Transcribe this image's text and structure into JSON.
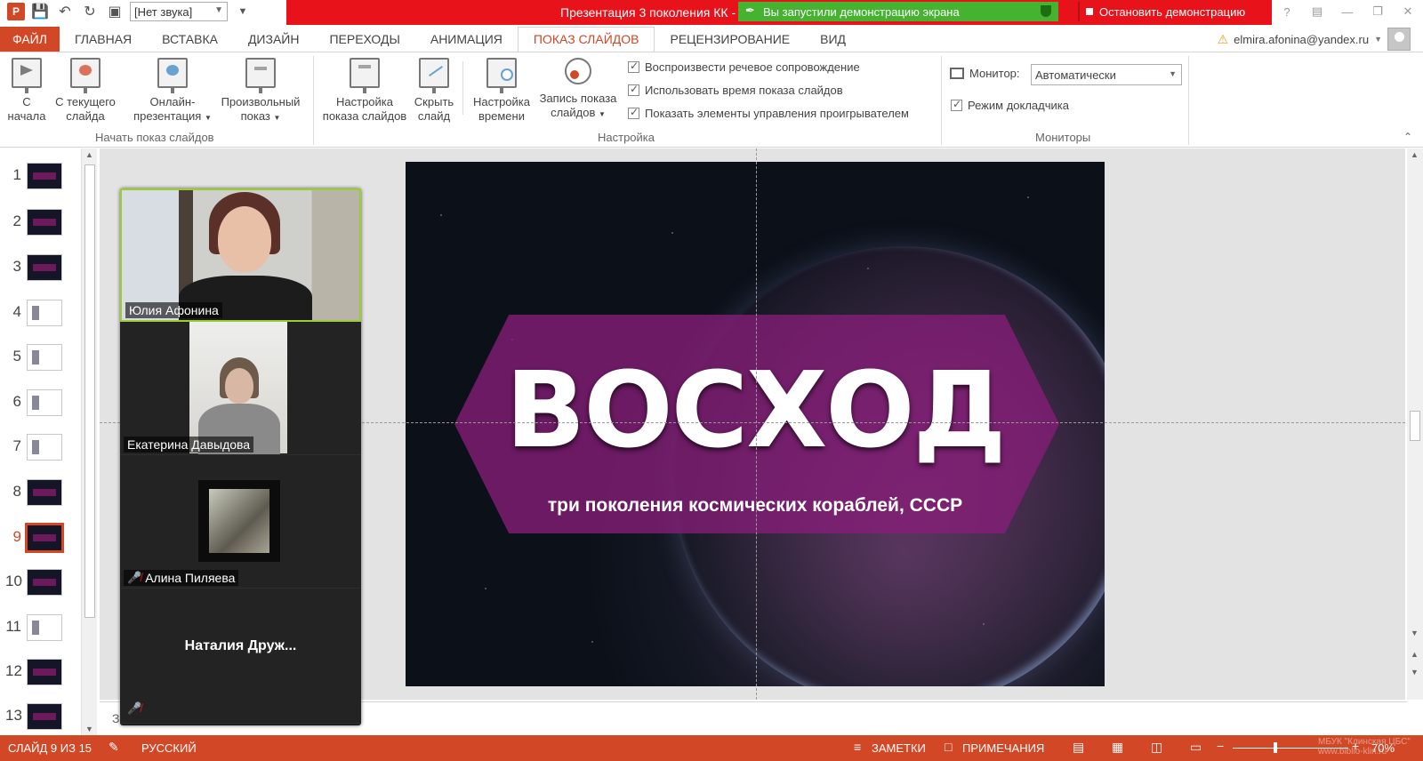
{
  "titlebar": {
    "sound_select": "[Нет звука]",
    "document_title": "Презентация 3 поколения КК -",
    "share_status": "Вы запустили демонстрацию экрана",
    "stop_button": "Остановить демонстрацию"
  },
  "tabs": [
    "ФАЙЛ",
    "ГЛАВНАЯ",
    "ВСТАВКА",
    "ДИЗАЙН",
    "ПЕРЕХОДЫ",
    "АНИМАЦИЯ",
    "ПОКАЗ СЛАЙДОВ",
    "РЕЦЕНЗИРОВАНИЕ",
    "ВИД"
  ],
  "account": {
    "email": "elmira.afonina@yandex.ru"
  },
  "ribbon": {
    "start_group": {
      "label": "Начать показ слайдов",
      "from_start_1": "С",
      "from_start_2": "начала",
      "from_current_1": "С текущего",
      "from_current_2": "слайда",
      "online_1": "Онлайн-",
      "online_2": "презентация",
      "custom_1": "Произвольный",
      "custom_2": "показ"
    },
    "setup_group": {
      "label": "Настройка",
      "setup_show_1": "Настройка",
      "setup_show_2": "показа слайдов",
      "hide_slide_1": "Скрыть",
      "hide_slide_2": "слайд",
      "timing_1": "Настройка",
      "timing_2": "времени",
      "record_1": "Запись показа",
      "record_2": "слайдов",
      "check_narration": "Воспроизвести речевое сопровождение",
      "check_timings": "Использовать время показа слайдов",
      "check_controls": "Показать элементы управления проигрывателем"
    },
    "monitors_group": {
      "label": "Мониторы",
      "monitor_label": "Монитор:",
      "monitor_value": "Автоматически",
      "presenter_view": "Режим докладчика"
    }
  },
  "slides": [
    "1",
    "2",
    "3",
    "4",
    "5",
    "6",
    "7",
    "8",
    "9",
    "10",
    "11",
    "12",
    "13"
  ],
  "current_slide": {
    "title": "ВОСХОД",
    "subtitle": "три поколения космических кораблей, СССР"
  },
  "notes_placeholder": "З",
  "participants": [
    {
      "name": "Юлия Афонина"
    },
    {
      "name": "Екатерина Давыдова"
    },
    {
      "name": "Алина Пиляева"
    },
    {
      "name": "Наталия  Друж..."
    }
  ],
  "statusbar": {
    "slide_counter": "СЛАЙД 9 ИЗ 15",
    "language": "РУССКИЙ",
    "notes": "ЗАМЕТКИ",
    "comments": "ПРИМЕЧАНИЯ",
    "zoom": "70%"
  },
  "watermark": {
    "line1": "МБУК \"Клинская ЦБС\"",
    "line2": "www.biblio-klin.ru"
  },
  "colors": {
    "accent": "#d24726",
    "share_green": "#45b230",
    "alert_red": "#e8121a"
  }
}
